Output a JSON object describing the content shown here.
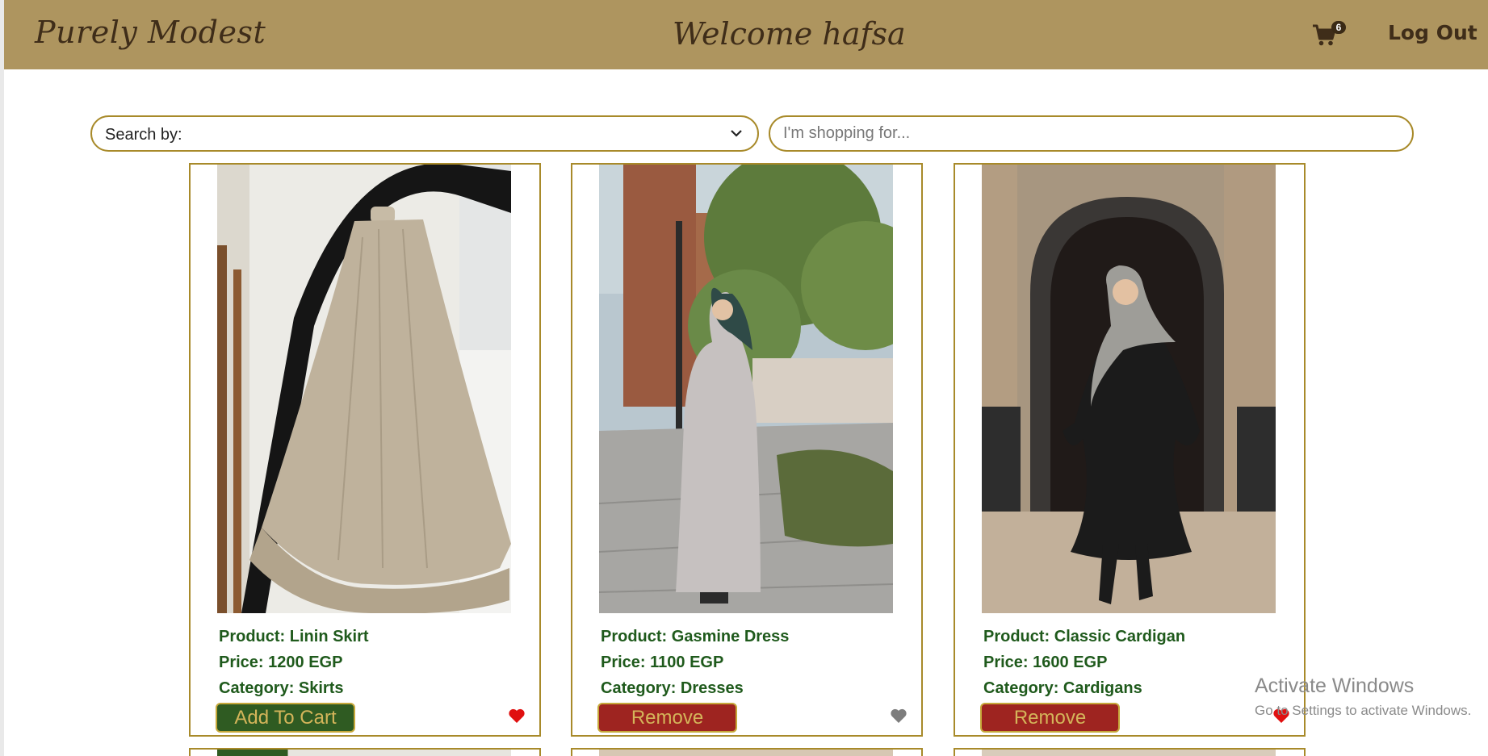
{
  "header": {
    "brand": "Purely Modest",
    "welcome": "Welcome hafsa",
    "cart_count": "6",
    "logout_label": "Log Out",
    "background_color": "#ae955f",
    "text_color": "#3f2d19"
  },
  "search": {
    "select_label": "Search by:",
    "input_placeholder": "I'm shopping for..."
  },
  "products": [
    {
      "product_label": "Product: Linin Skirt",
      "price_label": "Price: 1200 EGP",
      "category_label": "Category: Skirts",
      "button_label": "Add To Cart",
      "button_color": "#2f5b22",
      "favorite": true
    },
    {
      "product_label": "Product: Gasmine Dress",
      "price_label": "Price: 1100 EGP",
      "category_label": "Category: Dresses",
      "button_label": "Remove",
      "button_color": "#9e2420",
      "favorite": false
    },
    {
      "product_label": "Product: Classic Cardigan",
      "price_label": "Price: 1600 EGP",
      "category_label": "Category: Cardigans",
      "button_label": "Remove",
      "button_color": "#9e2420",
      "favorite": true
    }
  ],
  "watermark": {
    "line1": "Activate Windows",
    "line2": "Go to Settings to activate Windows."
  },
  "icons": {
    "cart": "shopping-cart-icon",
    "chevron": "chevron-down-icon",
    "heart": "heart-icon"
  }
}
